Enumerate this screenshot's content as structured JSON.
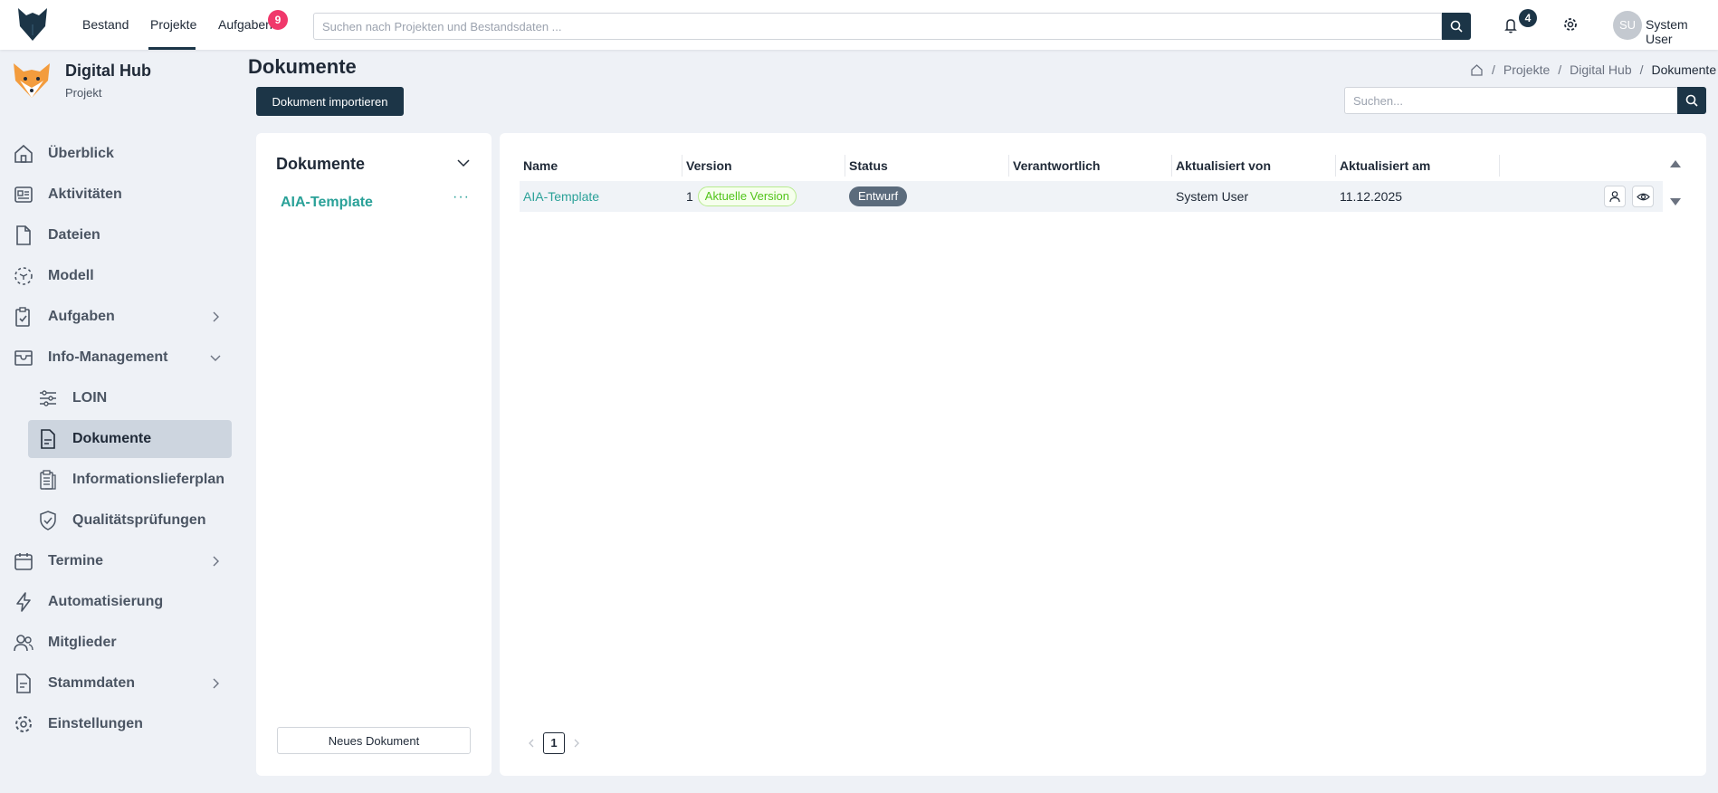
{
  "topbar": {
    "nav": [
      "Bestand",
      "Projekte",
      "Aufgaben"
    ],
    "active_nav": "Projekte",
    "tasks_badge": "9",
    "search_placeholder": "Suchen nach Projekten und Bestandsdaten ...",
    "notifications_badge": "4",
    "avatar_initials": "SU",
    "user_name": "System User"
  },
  "sidebar": {
    "project_title": "Digital Hub",
    "project_subtitle": "Projekt",
    "items": [
      {
        "label": "Überblick",
        "icon": "home-icon"
      },
      {
        "label": "Aktivitäten",
        "icon": "activity-icon"
      },
      {
        "label": "Dateien",
        "icon": "file-icon"
      },
      {
        "label": "Modell",
        "icon": "model-icon"
      },
      {
        "label": "Aufgaben",
        "icon": "clipboard-check-icon",
        "chevron": "right"
      },
      {
        "label": "Info-Management",
        "icon": "inbox-icon",
        "chevron": "down"
      },
      {
        "label": "Termine",
        "icon": "calendar-icon",
        "chevron": "right"
      },
      {
        "label": "Automatisierung",
        "icon": "lightning-icon"
      },
      {
        "label": "Mitglieder",
        "icon": "users-icon"
      },
      {
        "label": "Stammdaten",
        "icon": "document-icon",
        "chevron": "right"
      },
      {
        "label": "Einstellungen",
        "icon": "gear-icon"
      }
    ],
    "sub_items": [
      {
        "label": "LOIN",
        "icon": "sliders-icon"
      },
      {
        "label": "Dokumente",
        "icon": "document-lines-icon",
        "active": true
      },
      {
        "label": "Informationslieferplan",
        "icon": "clipboard-list-icon"
      },
      {
        "label": "Qualitätsprüfungen",
        "icon": "shield-check-icon"
      }
    ]
  },
  "header": {
    "title": "Dokumente",
    "breadcrumb": [
      "Projekte",
      "Digital Hub",
      "Dokumente"
    ],
    "import_button": "Dokument importieren",
    "search_placeholder": "Suchen..."
  },
  "left_panel": {
    "title": "Dokumente",
    "items": [
      "AIA-Template"
    ],
    "more": "···",
    "new_button": "Neues Dokument"
  },
  "table": {
    "columns": [
      "Name",
      "Version",
      "Status",
      "Verantwortlich",
      "Aktualisiert von",
      "Aktualisiert am"
    ],
    "rows": [
      {
        "name": "AIA-Template",
        "version": "1",
        "version_badge": "Aktuelle Version",
        "status": "Entwurf",
        "responsible": "",
        "updated_by": "System User",
        "updated_at": "11.12.2025"
      }
    ],
    "page": "1"
  },
  "colors": {
    "primary": "#1c3547",
    "accent": "#2aa198",
    "badge_red": "#f0386b",
    "success": "#52c41a"
  }
}
